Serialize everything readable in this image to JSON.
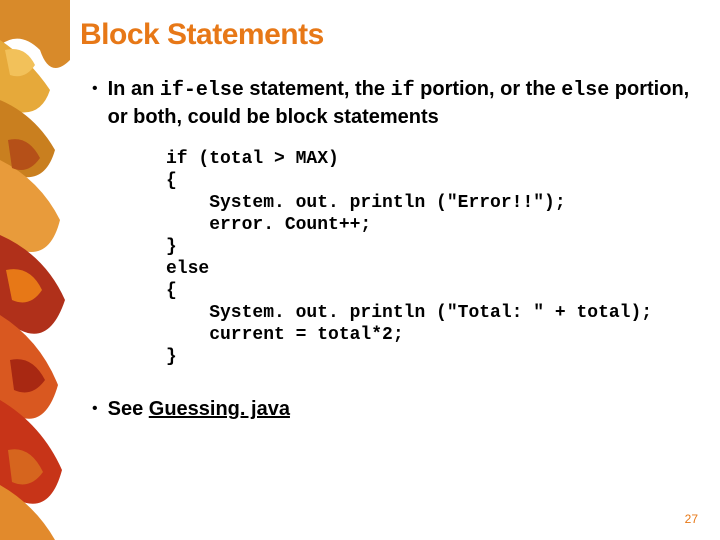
{
  "title": "Block Statements",
  "bullet1": {
    "prefix": "In an ",
    "code1": "if-else",
    "mid1": " statement, the ",
    "code2": "if",
    "mid2": " portion, or the ",
    "code3": "else",
    "suffix": " portion, or both, could be block statements"
  },
  "code": "if (total > MAX)\n{\n    System. out. println (\"Error!!\");\n    error. Count++;\n}\nelse\n{\n    System. out. println (\"Total: \" + total);\n    current = total*2;\n}",
  "bullet2": {
    "prefix": "See ",
    "link": "Guessing. java"
  },
  "pageNumber": "27"
}
